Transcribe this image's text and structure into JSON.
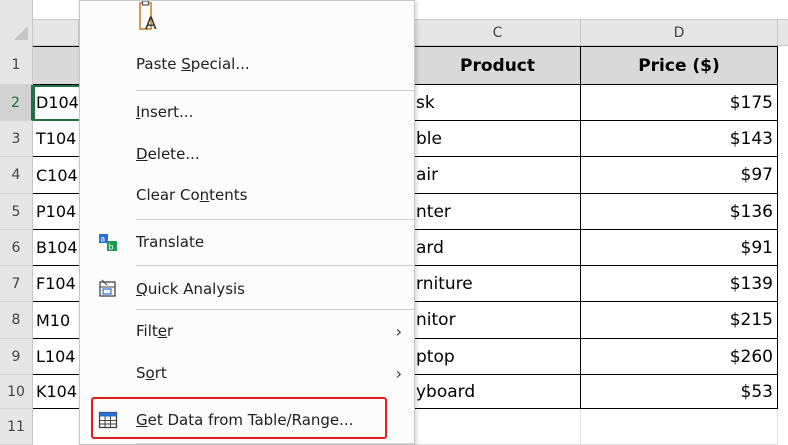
{
  "columns": [
    "C",
    "D"
  ],
  "rows": [
    "1",
    "2",
    "3",
    "4",
    "5",
    "6",
    "7",
    "8",
    "9",
    "10",
    "11"
  ],
  "headers": {
    "product": "Product",
    "price": "Price ($)"
  },
  "id_fragments": [
    "D104",
    "T104",
    "C104",
    "P104",
    "B104",
    "F104",
    "M10",
    "L104",
    "K104"
  ],
  "products": [
    "sk",
    "ble",
    "air",
    "nter",
    "ard",
    "rniture",
    "nitor",
    "ptop",
    "yboard"
  ],
  "prices": [
    "$175",
    "$143",
    "$97",
    "$136",
    "$91",
    "$139",
    "$215",
    "$260",
    "$53"
  ],
  "menu": {
    "paste_icon_letter": "A",
    "items": {
      "paste_special": {
        "pre": "Paste ",
        "key": "S",
        "post": "pecial..."
      },
      "insert": {
        "pre": "",
        "key": "I",
        "post": "nsert..."
      },
      "delete": {
        "pre": "",
        "key": "D",
        "post": "elete..."
      },
      "clear": {
        "pre": "Clear Co",
        "key": "n",
        "post": "tents"
      },
      "translate": {
        "pre": "Translate",
        "key": "",
        "post": ""
      },
      "quick_analysis": {
        "pre": "",
        "key": "Q",
        "post": "uick Analysis"
      },
      "filter": {
        "pre": "Filt",
        "key": "e",
        "post": "r"
      },
      "sort": {
        "pre": "S",
        "key": "o",
        "post": "rt"
      },
      "get_data": {
        "pre": "",
        "key": "G",
        "post": "et Data from Table/Range..."
      }
    },
    "submenu_arrow": "›"
  },
  "colors": {
    "selection": "#217346",
    "highlight": "#e51d1d"
  }
}
